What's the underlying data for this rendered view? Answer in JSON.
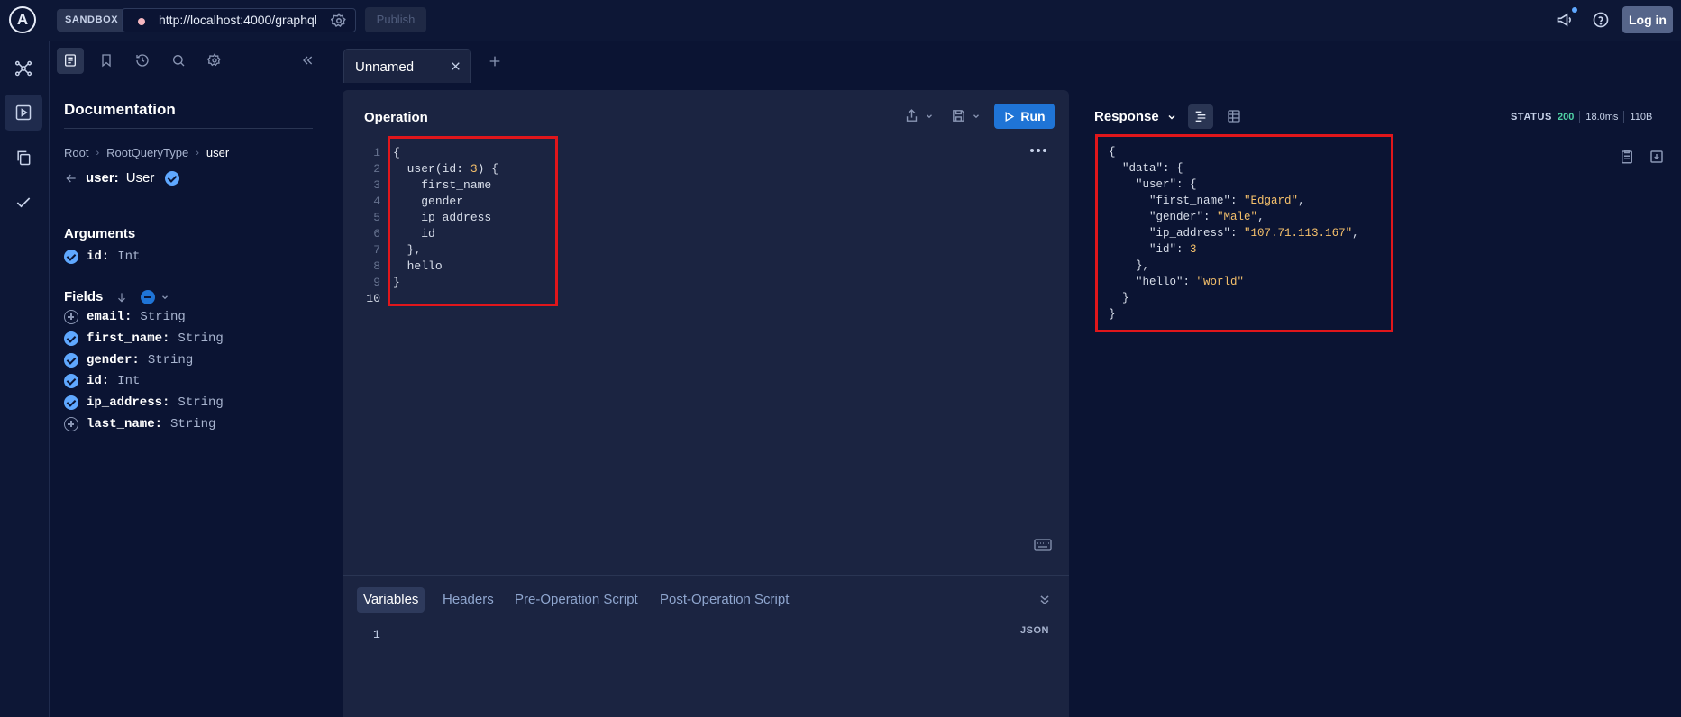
{
  "app": {
    "logo_letter": "A",
    "sandbox_label": "SANDBOX",
    "endpoint_url": "http://localhost:4000/graphql",
    "publish_label": "Publish",
    "login_label": "Log in"
  },
  "docs": {
    "title": "Documentation",
    "breadcrumb": [
      "Root",
      "RootQueryType",
      "user"
    ],
    "current_field": "user:",
    "current_type": "User",
    "arguments_heading": "Arguments",
    "arguments": [
      {
        "name": "id:",
        "type": "Int",
        "selected": true
      }
    ],
    "fields_heading": "Fields",
    "fields": [
      {
        "name": "email:",
        "type": "String",
        "selected": false
      },
      {
        "name": "first_name:",
        "type": "String",
        "selected": true
      },
      {
        "name": "gender:",
        "type": "String",
        "selected": true
      },
      {
        "name": "id:",
        "type": "Int",
        "selected": true
      },
      {
        "name": "ip_address:",
        "type": "String",
        "selected": true
      },
      {
        "name": "last_name:",
        "type": "String",
        "selected": false
      }
    ]
  },
  "tabs": [
    {
      "label": "Unnamed"
    }
  ],
  "operation": {
    "title": "Operation",
    "run_label": "Run",
    "line_numbers": [
      "1",
      "2",
      "3",
      "4",
      "5",
      "6",
      "7",
      "8",
      "9",
      "10"
    ],
    "lines": [
      {
        "indent": "",
        "text": "{"
      },
      {
        "indent": "  ",
        "text": "user(id: ",
        "arg": "3",
        "after": ") {"
      },
      {
        "indent": "    ",
        "text": "first_name"
      },
      {
        "indent": "    ",
        "text": "gender"
      },
      {
        "indent": "    ",
        "text": "ip_address"
      },
      {
        "indent": "    ",
        "text": "id"
      },
      {
        "indent": "  ",
        "text": "},"
      },
      {
        "indent": "  ",
        "text": "hello"
      },
      {
        "indent": "",
        "text": "}"
      },
      {
        "indent": "",
        "text": ""
      }
    ]
  },
  "variables": {
    "tabs": [
      "Variables",
      "Headers",
      "Pre-Operation Script",
      "Post-Operation Script"
    ],
    "active_tab": "Variables",
    "line_number": "1",
    "format_label": "JSON"
  },
  "response": {
    "title": "Response",
    "status_label": "STATUS",
    "status_code": "200",
    "time": "18.0ms",
    "size": "110B",
    "lines": [
      {
        "indent": "",
        "key": "",
        "punct": "{"
      },
      {
        "indent": "  ",
        "key": "\"data\"",
        "punct": ": {"
      },
      {
        "indent": "    ",
        "key": "\"user\"",
        "punct": ": {"
      },
      {
        "indent": "      ",
        "key": "\"first_name\"",
        "punct": ": ",
        "value": "\"Edgard\"",
        "tail": ","
      },
      {
        "indent": "      ",
        "key": "\"gender\"",
        "punct": ": ",
        "value": "\"Male\"",
        "tail": ","
      },
      {
        "indent": "      ",
        "key": "\"ip_address\"",
        "punct": ": ",
        "value": "\"107.71.113.167\"",
        "tail": ","
      },
      {
        "indent": "      ",
        "key": "\"id\"",
        "punct": ": ",
        "num": "3"
      },
      {
        "indent": "    ",
        "key": "",
        "punct": "},"
      },
      {
        "indent": "    ",
        "key": "\"hello\"",
        "punct": ": ",
        "value": "\"world\""
      },
      {
        "indent": "  ",
        "key": "",
        "punct": "}"
      },
      {
        "indent": "",
        "key": "",
        "punct": "}"
      }
    ]
  },
  "colors": {
    "accent": "#1f74d6",
    "check": "#5fa8ff",
    "highlight_border": "#e0161b",
    "status_ok": "#4fd1a5"
  }
}
